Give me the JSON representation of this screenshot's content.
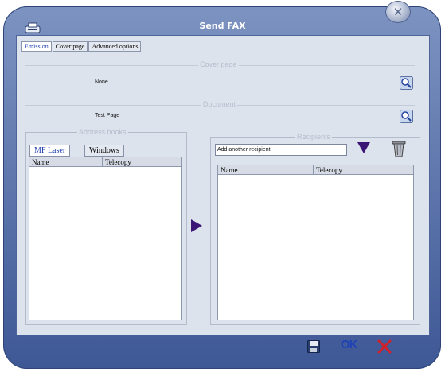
{
  "window": {
    "title": "Send FAX"
  },
  "tabs": [
    {
      "label": "Emission",
      "active": true
    },
    {
      "label": "Cover page",
      "active": false
    },
    {
      "label": "Advanced options",
      "active": false
    }
  ],
  "cover_page": {
    "legend": "Cover page",
    "value": "None"
  },
  "document": {
    "legend": "Document",
    "value": "Test Page"
  },
  "address_books": {
    "legend": "Address books",
    "tabs": [
      {
        "label": "MF Laser",
        "active": true
      },
      {
        "label": "Windows",
        "active": false
      }
    ],
    "columns": [
      "Name",
      "Telecopy"
    ]
  },
  "recipients": {
    "legend": "Recipients",
    "input_value": "Add another recipient",
    "columns": [
      "Name",
      "Telecopy"
    ]
  },
  "colors": {
    "accent": "#3a1575",
    "frame": "#5b73a9",
    "ok": "#1f41b8",
    "cancel": "#d0202a"
  },
  "icons": [
    "fax-icon",
    "close-icon",
    "magnifier-icon",
    "arrow-right-icon",
    "arrow-down-icon",
    "trash-icon",
    "save-icon"
  ]
}
